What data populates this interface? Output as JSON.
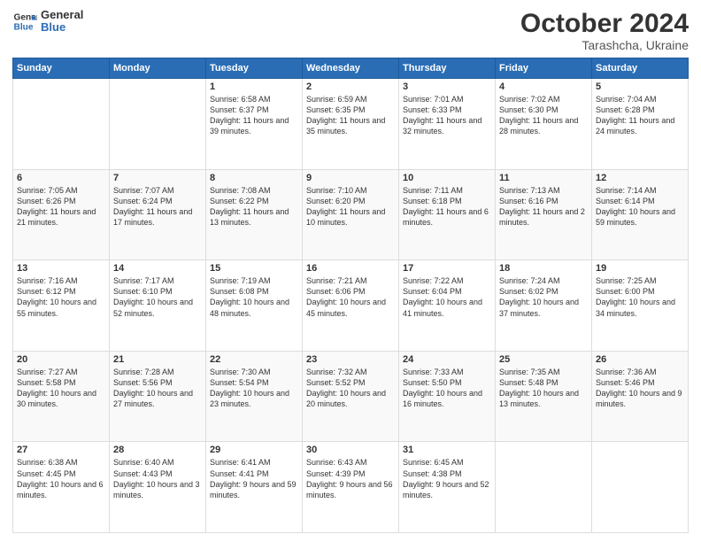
{
  "logo": {
    "line1": "General",
    "line2": "Blue"
  },
  "title": "October 2024",
  "subtitle": "Tarashcha, Ukraine",
  "weekdays": [
    "Sunday",
    "Monday",
    "Tuesday",
    "Wednesday",
    "Thursday",
    "Friday",
    "Saturday"
  ],
  "weeks": [
    [
      {
        "day": "",
        "text": ""
      },
      {
        "day": "",
        "text": ""
      },
      {
        "day": "1",
        "text": "Sunrise: 6:58 AM\nSunset: 6:37 PM\nDaylight: 11 hours and 39 minutes."
      },
      {
        "day": "2",
        "text": "Sunrise: 6:59 AM\nSunset: 6:35 PM\nDaylight: 11 hours and 35 minutes."
      },
      {
        "day": "3",
        "text": "Sunrise: 7:01 AM\nSunset: 6:33 PM\nDaylight: 11 hours and 32 minutes."
      },
      {
        "day": "4",
        "text": "Sunrise: 7:02 AM\nSunset: 6:30 PM\nDaylight: 11 hours and 28 minutes."
      },
      {
        "day": "5",
        "text": "Sunrise: 7:04 AM\nSunset: 6:28 PM\nDaylight: 11 hours and 24 minutes."
      }
    ],
    [
      {
        "day": "6",
        "text": "Sunrise: 7:05 AM\nSunset: 6:26 PM\nDaylight: 11 hours and 21 minutes."
      },
      {
        "day": "7",
        "text": "Sunrise: 7:07 AM\nSunset: 6:24 PM\nDaylight: 11 hours and 17 minutes."
      },
      {
        "day": "8",
        "text": "Sunrise: 7:08 AM\nSunset: 6:22 PM\nDaylight: 11 hours and 13 minutes."
      },
      {
        "day": "9",
        "text": "Sunrise: 7:10 AM\nSunset: 6:20 PM\nDaylight: 11 hours and 10 minutes."
      },
      {
        "day": "10",
        "text": "Sunrise: 7:11 AM\nSunset: 6:18 PM\nDaylight: 11 hours and 6 minutes."
      },
      {
        "day": "11",
        "text": "Sunrise: 7:13 AM\nSunset: 6:16 PM\nDaylight: 11 hours and 2 minutes."
      },
      {
        "day": "12",
        "text": "Sunrise: 7:14 AM\nSunset: 6:14 PM\nDaylight: 10 hours and 59 minutes."
      }
    ],
    [
      {
        "day": "13",
        "text": "Sunrise: 7:16 AM\nSunset: 6:12 PM\nDaylight: 10 hours and 55 minutes."
      },
      {
        "day": "14",
        "text": "Sunrise: 7:17 AM\nSunset: 6:10 PM\nDaylight: 10 hours and 52 minutes."
      },
      {
        "day": "15",
        "text": "Sunrise: 7:19 AM\nSunset: 6:08 PM\nDaylight: 10 hours and 48 minutes."
      },
      {
        "day": "16",
        "text": "Sunrise: 7:21 AM\nSunset: 6:06 PM\nDaylight: 10 hours and 45 minutes."
      },
      {
        "day": "17",
        "text": "Sunrise: 7:22 AM\nSunset: 6:04 PM\nDaylight: 10 hours and 41 minutes."
      },
      {
        "day": "18",
        "text": "Sunrise: 7:24 AM\nSunset: 6:02 PM\nDaylight: 10 hours and 37 minutes."
      },
      {
        "day": "19",
        "text": "Sunrise: 7:25 AM\nSunset: 6:00 PM\nDaylight: 10 hours and 34 minutes."
      }
    ],
    [
      {
        "day": "20",
        "text": "Sunrise: 7:27 AM\nSunset: 5:58 PM\nDaylight: 10 hours and 30 minutes."
      },
      {
        "day": "21",
        "text": "Sunrise: 7:28 AM\nSunset: 5:56 PM\nDaylight: 10 hours and 27 minutes."
      },
      {
        "day": "22",
        "text": "Sunrise: 7:30 AM\nSunset: 5:54 PM\nDaylight: 10 hours and 23 minutes."
      },
      {
        "day": "23",
        "text": "Sunrise: 7:32 AM\nSunset: 5:52 PM\nDaylight: 10 hours and 20 minutes."
      },
      {
        "day": "24",
        "text": "Sunrise: 7:33 AM\nSunset: 5:50 PM\nDaylight: 10 hours and 16 minutes."
      },
      {
        "day": "25",
        "text": "Sunrise: 7:35 AM\nSunset: 5:48 PM\nDaylight: 10 hours and 13 minutes."
      },
      {
        "day": "26",
        "text": "Sunrise: 7:36 AM\nSunset: 5:46 PM\nDaylight: 10 hours and 9 minutes."
      }
    ],
    [
      {
        "day": "27",
        "text": "Sunrise: 6:38 AM\nSunset: 4:45 PM\nDaylight: 10 hours and 6 minutes."
      },
      {
        "day": "28",
        "text": "Sunrise: 6:40 AM\nSunset: 4:43 PM\nDaylight: 10 hours and 3 minutes."
      },
      {
        "day": "29",
        "text": "Sunrise: 6:41 AM\nSunset: 4:41 PM\nDaylight: 9 hours and 59 minutes."
      },
      {
        "day": "30",
        "text": "Sunrise: 6:43 AM\nSunset: 4:39 PM\nDaylight: 9 hours and 56 minutes."
      },
      {
        "day": "31",
        "text": "Sunrise: 6:45 AM\nSunset: 4:38 PM\nDaylight: 9 hours and 52 minutes."
      },
      {
        "day": "",
        "text": ""
      },
      {
        "day": "",
        "text": ""
      }
    ]
  ]
}
